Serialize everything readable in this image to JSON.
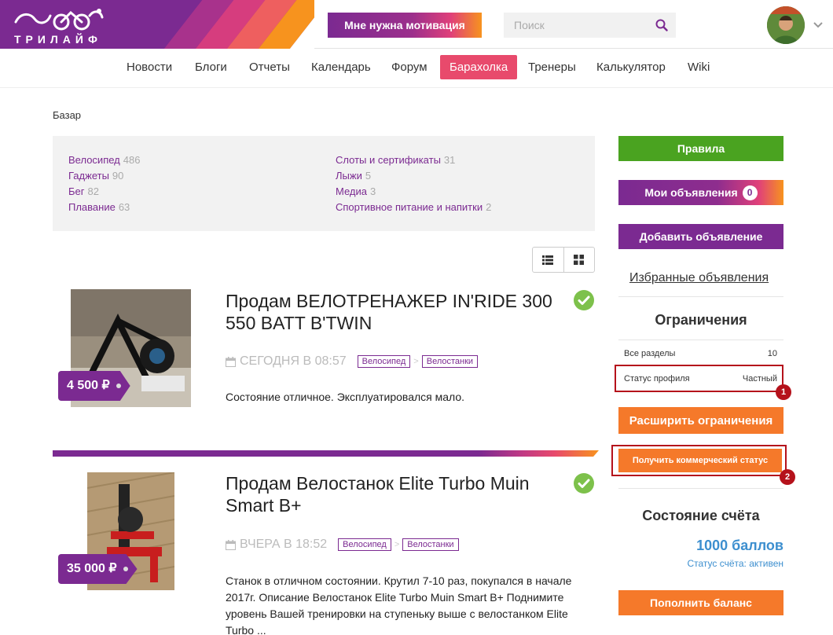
{
  "header": {
    "logo_text": "ТРИЛАЙФ",
    "motivation_button": "Мне нужна мотивация",
    "search_placeholder": "Поиск"
  },
  "nav": {
    "items": [
      {
        "label": "Новости"
      },
      {
        "label": "Блоги"
      },
      {
        "label": "Отчеты"
      },
      {
        "label": "Календарь"
      },
      {
        "label": "Форум"
      },
      {
        "label": "Барахолка",
        "active": true
      },
      {
        "label": "Тренеры"
      },
      {
        "label": "Калькулятор"
      },
      {
        "label": "Wiki"
      }
    ]
  },
  "breadcrumb": "Базар",
  "categories": [
    {
      "name": "Велосипед",
      "count": "486"
    },
    {
      "name": "Гаджеты",
      "count": "90"
    },
    {
      "name": "Бег",
      "count": "82"
    },
    {
      "name": "Плавание",
      "count": "63"
    },
    {
      "name": "Слоты и сертификаты",
      "count": "31"
    },
    {
      "name": "Лыжи",
      "count": "5"
    },
    {
      "name": "Медиа",
      "count": "3"
    },
    {
      "name": "Спортивное питание и напитки",
      "count": "2"
    }
  ],
  "listings": [
    {
      "title": "Продам ВЕЛОТРЕНАЖЕР IN'RIDE 300 550 BATT B'TWIN",
      "price": "4 500 ₽",
      "date": "СЕГОДНЯ В 08:57",
      "tags": [
        "Велосипед",
        "Велостанки"
      ],
      "description": "Состояние отличное. Эксплуатировался мало."
    },
    {
      "title": "Продам Велостанок Elite Turbo Muin Smart B+",
      "price": "35 000 ₽",
      "date": "ВЧЕРА В 18:52",
      "tags": [
        "Велосипед",
        "Велостанки"
      ],
      "description": "Станок в отличном состоянии. Крутил 7-10 раз, покупался в начале 2017г. Описание Велостанок Elite Turbo Muin Smart B+ Поднимите уровень Вашей тренировки на ступеньку выше с велостанком Elite Turbo ..."
    }
  ],
  "sidebar": {
    "rules_button": "Правила",
    "my_ads_button": "Мои объявления",
    "my_ads_count": "0",
    "add_ad_button": "Добавить объявление",
    "favorites_link": "Избранные объявления",
    "limits_title": "Ограничения",
    "limits": [
      {
        "label": "Все разделы",
        "value": "10"
      },
      {
        "label": "Статус профиля",
        "value": "Частный"
      }
    ],
    "expand_limits_button": "Расширить ограничения",
    "commercial_button": "Получить коммерческий статус",
    "annotations": [
      "1",
      "2"
    ],
    "account_title": "Состояние счёта",
    "balance": "1000 баллов",
    "account_status": "Статус счёта: активен",
    "top_up_button": "Пополнить баланс"
  },
  "colors": {
    "brand_purple": "#7b2a91",
    "accent_pink": "#e84a6c",
    "accent_orange": "#f5792a",
    "green": "#4aa320",
    "highlight_red": "#b5121b",
    "balance_blue": "#3d8fcf"
  }
}
